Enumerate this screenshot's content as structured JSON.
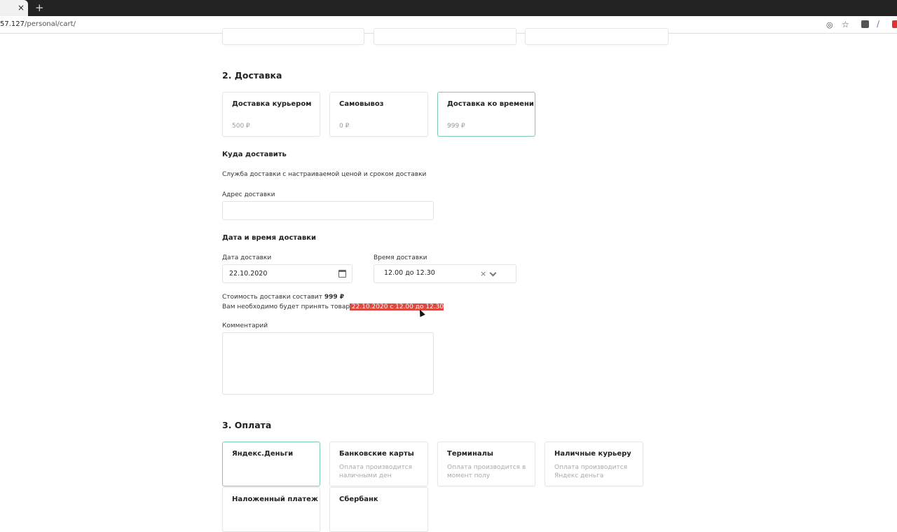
{
  "browser": {
    "url_host": "57.127",
    "url_path": "/personal/cart/",
    "tab_close": "×",
    "new_tab": "+"
  },
  "delivery": {
    "title": "2. Доставка",
    "options": [
      {
        "label": "Доставка курьером",
        "price": "500 ₽"
      },
      {
        "label": "Самовывоз",
        "price": "0 ₽"
      },
      {
        "label": "Доставка ко времени",
        "price": "999 ₽",
        "selected": true
      }
    ],
    "where_title": "Куда доставить",
    "service_desc": "Служба доставки с настраиваемой ценой и сроком доставки",
    "address_label": "Адрес доставки",
    "address_value": "",
    "datetime_title": "Дата и время доставки",
    "date_label": "Дата доставки",
    "date_value": "22.10.2020",
    "time_label": "Время доставки",
    "time_value": "12.00 до 12.30",
    "cost_text": "Стоимость доставки составит ",
    "cost_value": "999 ₽",
    "accept_text": "Вам необходимо будет принять товар",
    "accept_value": " 22.10.2020 с 12.00 до 12.30",
    "comment_label": "Комментарий",
    "comment_value": ""
  },
  "payment": {
    "title": "3. Оплата",
    "options": [
      {
        "label": "Яндекс.Деньги",
        "desc": "",
        "selected": true
      },
      {
        "label": "Банковские карты",
        "desc": "Оплата производится наличными ден"
      },
      {
        "label": "Терминалы",
        "desc": "Оплата производится в момент полу"
      },
      {
        "label": "Наличные курьеру",
        "desc": "Оплата производится Яндекс деньга"
      },
      {
        "label": "Наложенный платеж",
        "desc": ""
      },
      {
        "label": "Сбербанк",
        "desc": ""
      }
    ]
  },
  "colors": {
    "accent": "#7fcab6",
    "highlight": "#e0493f"
  }
}
